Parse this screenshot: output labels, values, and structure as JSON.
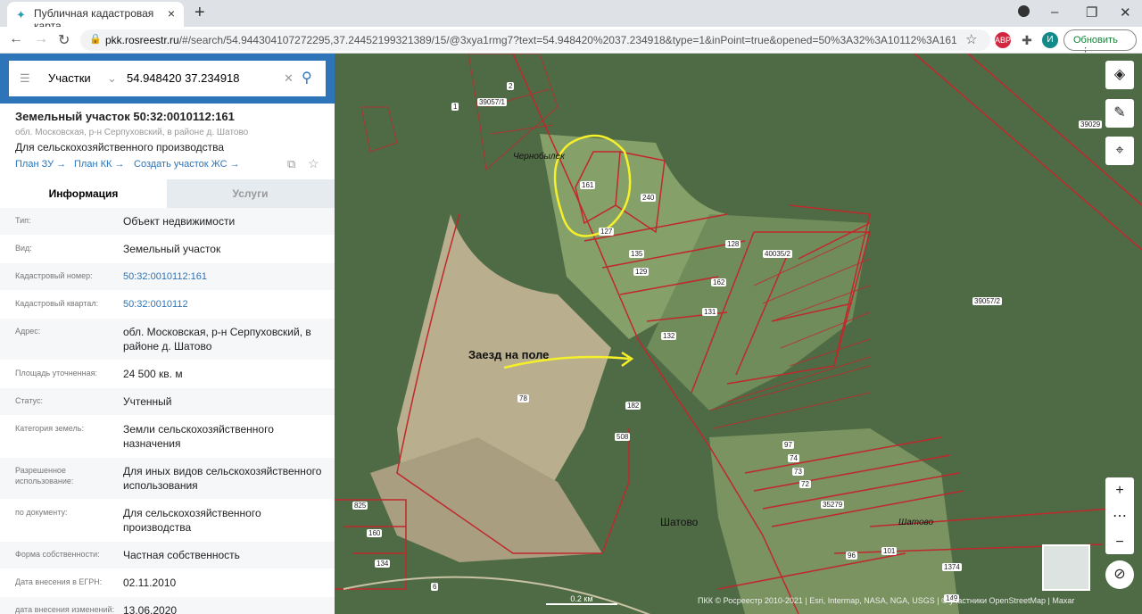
{
  "browser": {
    "tab_title": "Публичная кадастровая карта",
    "url_host": "pkk.rosreestr.ru",
    "url_path": "/#/search/54.944304107272295,37.24452199321389/15/@3xya1rmg7?text=54.948420%2037.234918&type=1&inPoint=true&opened=50%3A32%3A10112%3A161",
    "profile_initial": "И",
    "abp": "ABP",
    "update_label": "Обновить"
  },
  "search": {
    "type": "Участки",
    "value": "54.948420 37.234918"
  },
  "parcel": {
    "title": "Земельный участок 50:32:0010112:161",
    "address_short": "обл. Московская, р-н Серпуховский, в районе д. Шатово",
    "purpose": "Для сельскохозяйственного производства",
    "links": [
      "План ЗУ →",
      "План КК →",
      "Создать участок ЖС →"
    ]
  },
  "tabs": [
    "Информация",
    "Услуги"
  ],
  "info": [
    {
      "k": "Тип:",
      "v": "Объект недвижимости"
    },
    {
      "k": "Вид:",
      "v": "Земельный участок"
    },
    {
      "k": "Кадастровый номер:",
      "v": "50:32:0010112:161",
      "link": true
    },
    {
      "k": "Кадастровый квартал:",
      "v": "50:32:0010112",
      "link": true
    },
    {
      "k": "Адрес:",
      "v": "обл. Московская, р-н Серпуховский, в районе д. Шатово"
    },
    {
      "k": "Площадь уточненная:",
      "v": "24 500 кв. м"
    },
    {
      "k": "Статус:",
      "v": "Учтенный"
    },
    {
      "k": "Категория земель:",
      "v": "Земли сельскохозяйственного назначения"
    },
    {
      "k": "Разрешенное использование:",
      "v": "Для иных видов сельскохозяйственного использования"
    },
    {
      "k": "по документу:",
      "v": "Для сельскохозяйственного производства"
    },
    {
      "k": "Форма собственности:",
      "v": "Частная собственность"
    },
    {
      "k": "Дата внесения в ЕГРН:",
      "v": "02.11.2010"
    },
    {
      "k": "дата внесения изменений:",
      "v": "13.06.2020"
    }
  ],
  "map": {
    "labels": {
      "l161": "161",
      "l240": "240",
      "l127": "127",
      "l128": "128",
      "l135": "135",
      "l129": "129",
      "l162": "162",
      "l131": "131",
      "l132": "132",
      "l39057_1": "39057/1",
      "l39029": "39029",
      "l39057_2": "39057/2",
      "l40035": "40035/2",
      "l78": "78",
      "l182": "182",
      "l508": "508",
      "l97": "97",
      "l74": "74",
      "l73": "73",
      "l72": "72",
      "l35279": "35279",
      "l96": "96",
      "l101": "101",
      "l1374": "1374",
      "l149": "149",
      "l825": "825",
      "l160": "160",
      "l134": "134",
      "l6": "6",
      "l1": "1",
      "l2": "2"
    },
    "place1": "Чернобылек",
    "place2": "Шатово",
    "place3": "Шатово",
    "annotation": "Заезд на поле",
    "scale": "0.2 км",
    "attribution": "ПКК © Росреестр 2010-2021 | Esri, Intermap, NASA, NGA, USGS | © участники OpenStreetMap | Maxar"
  },
  "colors": {
    "accent": "#2d74b8",
    "parcel": "#c0282d",
    "annotation": "#f5f02a"
  }
}
